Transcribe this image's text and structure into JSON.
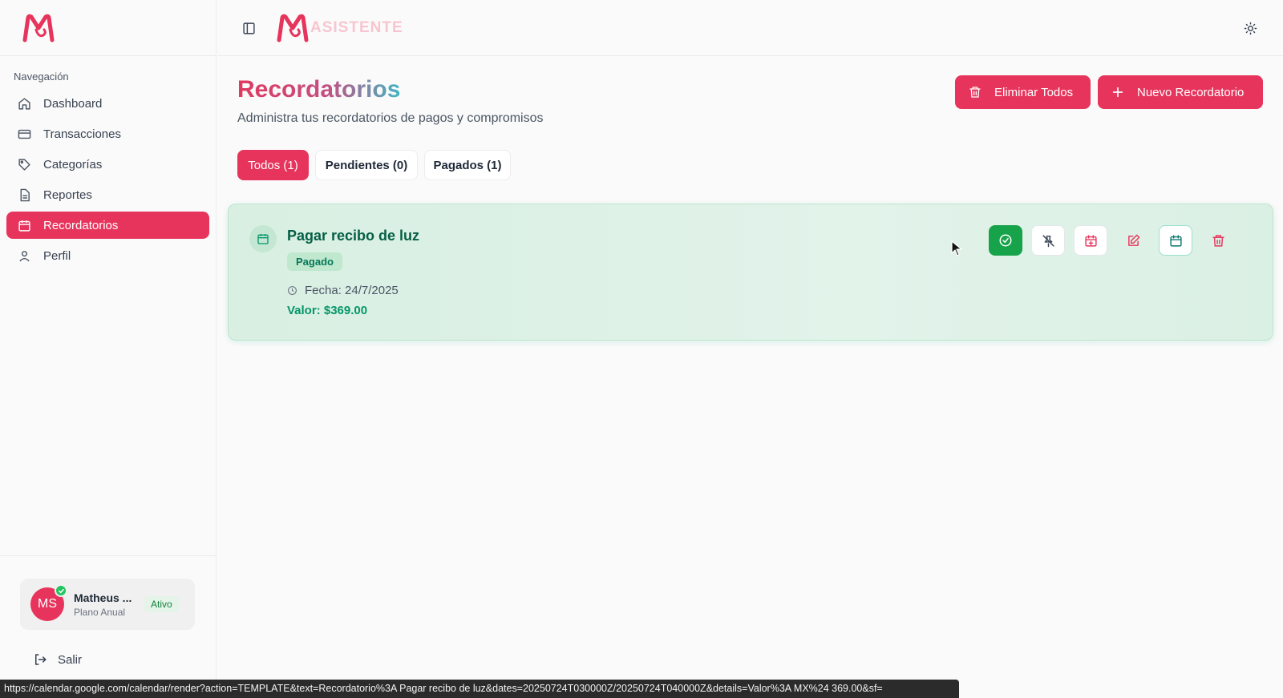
{
  "app": {
    "brand_text": "Asistente"
  },
  "sidebar": {
    "section_label": "Navegación",
    "items": [
      {
        "label": "Dashboard",
        "icon": "home-icon"
      },
      {
        "label": "Transacciones",
        "icon": "credit-card-icon"
      },
      {
        "label": "Categorías",
        "icon": "tag-icon"
      },
      {
        "label": "Reportes",
        "icon": "file-text-icon"
      },
      {
        "label": "Recordatorios",
        "icon": "calendar-icon",
        "active": true
      },
      {
        "label": "Perfil",
        "icon": "user-icon"
      }
    ],
    "user": {
      "initials": "MS",
      "name": "Matheus ...",
      "plan": "Plano Anual",
      "status": "Ativo"
    },
    "logout_label": "Salir"
  },
  "page": {
    "title": "Recordatorios",
    "subtitle": "Administra tus recordatorios de pagos y compromisos",
    "delete_all_label": "Eliminar Todos",
    "new_label": "Nuevo Recordatorio",
    "tabs": [
      {
        "label": "Todos (1)",
        "active": true
      },
      {
        "label": "Pendientes (0)"
      },
      {
        "label": "Pagados (1)"
      }
    ]
  },
  "reminders": [
    {
      "title": "Pagar recibo de luz",
      "badge": "Pagado",
      "date_text": "Fecha: 24/7/2025",
      "value_text": "Valor: $369.00"
    }
  ],
  "colors": {
    "accent": "#e7345c",
    "success": "#16a34a",
    "card_bg": "#dcf0e4"
  },
  "statusbar": {
    "url": "https://calendar.google.com/calendar/render?action=TEMPLATE&text=Recordatorio%3A Pagar recibo de luz&dates=20250724T030000Z/20250724T040000Z&details=Valor%3A MX%24 369.00&sf="
  }
}
